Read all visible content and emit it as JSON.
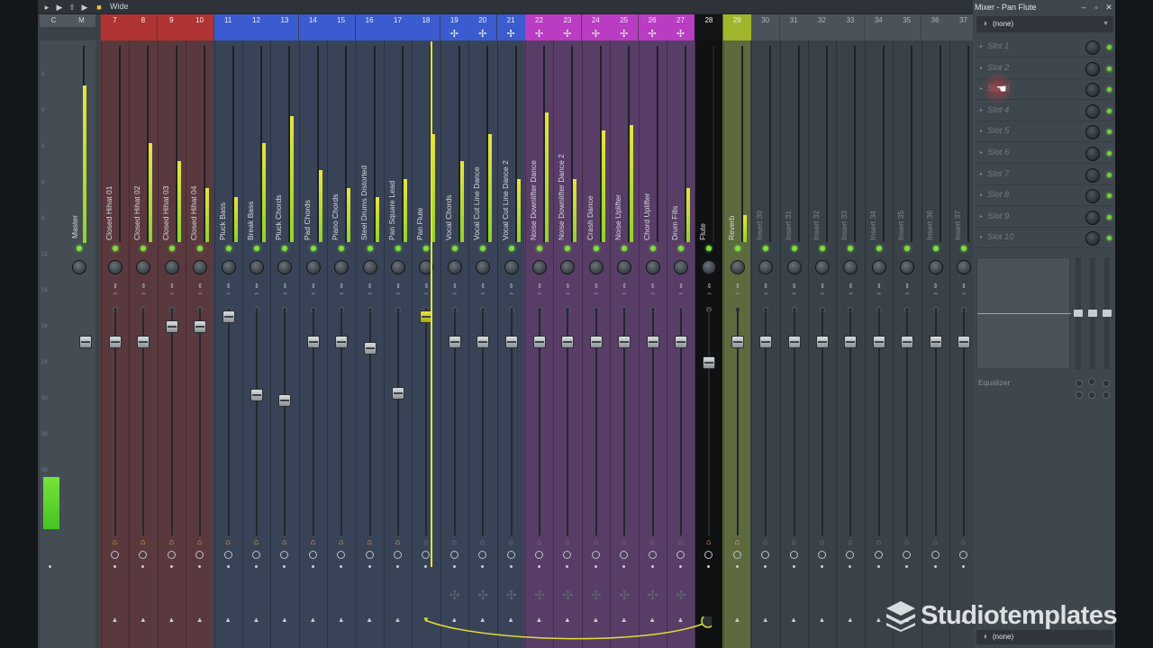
{
  "toolbar": {
    "view_label": "Wide"
  },
  "panel": {
    "title": "Mixer - Pan Flute",
    "preset_top": "(none)",
    "preset_bottom": "(none)",
    "slots": [
      "Slot 1",
      "Slot 2",
      "Slot 3",
      "Slot 4",
      "Slot 5",
      "Slot 6",
      "Slot 7",
      "Slot 8",
      "Slot 9",
      "Slot 10"
    ],
    "eq_label": "Equalizer"
  },
  "master": {
    "numbers": [
      "C",
      "M"
    ],
    "name": "Master"
  },
  "colors": {
    "red": "#b13434",
    "blue": "#3b5bd0",
    "magenta": "#b93cc3",
    "olive": "#a0b52c",
    "meter": "#9ede2e"
  },
  "groups": [
    {
      "numbers": [
        "7",
        "8",
        "9",
        "10"
      ],
      "color": "red"
    },
    {
      "numbers": [
        "11",
        "12",
        "13",
        "14",
        "15",
        "16",
        "17",
        "18",
        "19",
        "20",
        "21"
      ],
      "color": "blue"
    },
    {
      "numbers": [
        "22",
        "23",
        "24",
        "25",
        "26",
        "27"
      ],
      "color": "magenta"
    },
    {
      "numbers": [
        "29"
      ],
      "color": "olive"
    }
  ],
  "channels": [
    {
      "num": "7",
      "name": "Closed Hihat 01",
      "tint": "red"
    },
    {
      "num": "8",
      "name": "Closed Hihat 02",
      "tint": "red"
    },
    {
      "num": "9",
      "name": "Closed Hihat 03",
      "tint": "red"
    },
    {
      "num": "10",
      "name": "Closed Hihat 04",
      "tint": "red"
    },
    {
      "num": "11",
      "name": "Pluck Bass",
      "tint": "blue"
    },
    {
      "num": "12",
      "name": "Break Bass",
      "tint": "blue"
    },
    {
      "num": "13",
      "name": "Pluck Chords",
      "tint": "blue"
    },
    {
      "num": "14",
      "name": "Pad Chords",
      "tint": "blue"
    },
    {
      "num": "15",
      "name": "Piano Chords",
      "tint": "blue"
    },
    {
      "num": "16",
      "name": "Steel Drums Distorted",
      "tint": "blue"
    },
    {
      "num": "17",
      "name": "Pan Square Lead",
      "tint": "blue"
    },
    {
      "num": "18",
      "name": "Pan Flute",
      "tint": "blue"
    },
    {
      "num": "19",
      "name": "Vocal Chords",
      "tint": "blue"
    },
    {
      "num": "20",
      "name": "Vocal Cut Line Dance",
      "tint": "blue"
    },
    {
      "num": "21",
      "name": "Vocal Cut Line Dance 2",
      "tint": "blue"
    },
    {
      "num": "22",
      "name": "Noise Downlifter Dance",
      "tint": "magenta"
    },
    {
      "num": "23",
      "name": "Noise Downlifter Dance 2",
      "tint": "magenta"
    },
    {
      "num": "24",
      "name": "Crash Dance",
      "tint": "magenta"
    },
    {
      "num": "25",
      "name": "Noise Uplifter",
      "tint": "magenta"
    },
    {
      "num": "26",
      "name": "Chord Uplifter",
      "tint": "magenta"
    },
    {
      "num": "27",
      "name": "Drum Fills",
      "tint": "magenta"
    },
    {
      "num": "28",
      "name": "Flute",
      "tint": "black"
    },
    {
      "num": "29",
      "name": "Reverb",
      "tint": "olive"
    },
    {
      "num": "30",
      "name": "Insert 30",
      "tint": "none"
    },
    {
      "num": "31",
      "name": "Insert 31",
      "tint": "none"
    },
    {
      "num": "32",
      "name": "Insert 32",
      "tint": "none"
    },
    {
      "num": "33",
      "name": "Insert 33",
      "tint": "none"
    },
    {
      "num": "34",
      "name": "Insert 34",
      "tint": "none"
    },
    {
      "num": "35",
      "name": "Insert 35",
      "tint": "none"
    },
    {
      "num": "36",
      "name": "Insert 36",
      "tint": "none"
    },
    {
      "num": "37",
      "name": "Insert 37",
      "tint": "none"
    }
  ],
  "watermark": "Studiotemplates"
}
